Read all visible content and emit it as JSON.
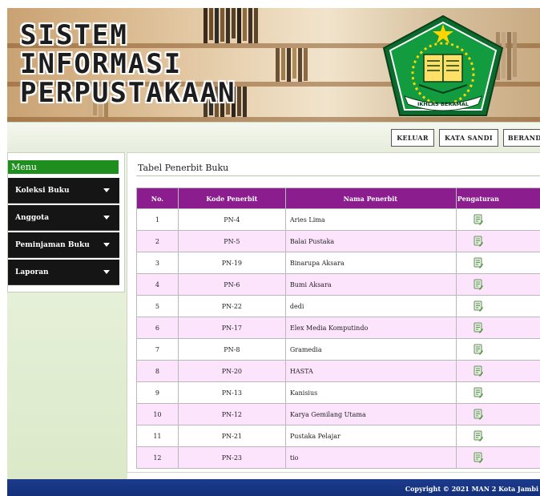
{
  "header": {
    "title_lines": [
      "SISTEM",
      "INFORMASI",
      "PERPUSTAKAAN"
    ],
    "logo_motto": "IKHLAS BERAMAL"
  },
  "topbar": {
    "logout_label": "KELUAR",
    "password_label": "KATA SANDI",
    "home_label": "BERANDA"
  },
  "sidebar": {
    "heading": "Menu",
    "items": [
      {
        "label": "Koleksi Buku"
      },
      {
        "label": "Anggota"
      },
      {
        "label": "Peminjaman Buku"
      },
      {
        "label": "Laporan"
      }
    ]
  },
  "main": {
    "title": "Tabel Penerbit Buku",
    "columns": [
      "No.",
      "Kode Penerbit",
      "Nama Penerbit",
      "Pengaturan"
    ],
    "rows": [
      {
        "no": "1",
        "code": "PN-4",
        "name": "Aries Lima"
      },
      {
        "no": "2",
        "code": "PN-5",
        "name": "Balai Pustaka"
      },
      {
        "no": "3",
        "code": "PN-19",
        "name": "Binarupa Aksara"
      },
      {
        "no": "4",
        "code": "PN-6",
        "name": "Bumi Aksara"
      },
      {
        "no": "5",
        "code": "PN-22",
        "name": "dedi"
      },
      {
        "no": "6",
        "code": "PN-17",
        "name": "Elex Media Komputindo"
      },
      {
        "no": "7",
        "code": "PN-8",
        "name": "Gramedia"
      },
      {
        "no": "8",
        "code": "PN-20",
        "name": "HASTA"
      },
      {
        "no": "9",
        "code": "PN-13",
        "name": "Kanisius"
      },
      {
        "no": "10",
        "code": "PN-12",
        "name": "Karya Gemilang Utama"
      },
      {
        "no": "11",
        "code": "PN-21",
        "name": "Pustaka Pelajar"
      },
      {
        "no": "12",
        "code": "PN-23",
        "name": "tio"
      }
    ]
  },
  "footer": {
    "text": "Copyright © 2021 MAN 2 Kota Jambi"
  },
  "icons": {
    "row_action": "edit-icon",
    "menu_toggle": "chevron-down-icon"
  },
  "colors": {
    "menu_heading_bg": "#1e8f1e",
    "table_header_bg": "#8b1d8e",
    "row_alt_bg": "#fde4fd",
    "footer_bg": "#14307a",
    "sidebar_item_bg": "#151515"
  }
}
